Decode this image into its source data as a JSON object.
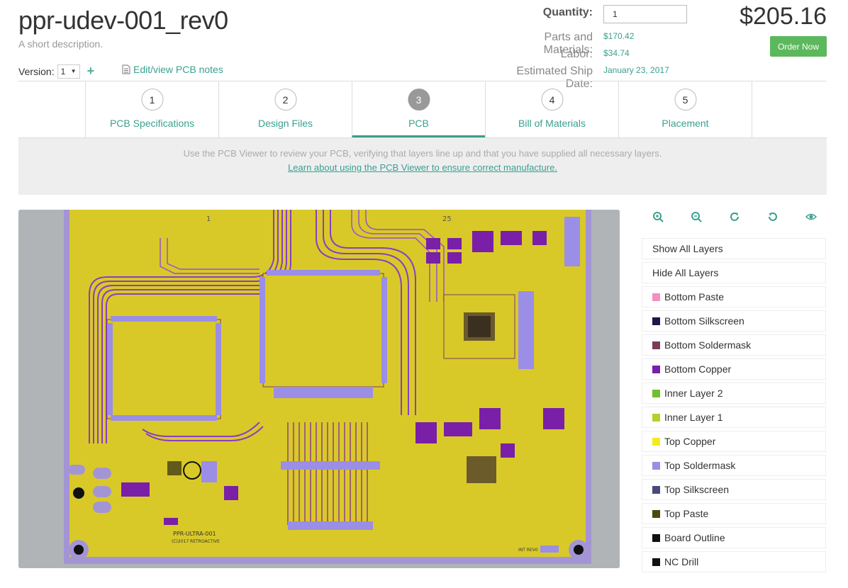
{
  "header": {
    "title": "ppr-udev-001_rev0",
    "description": "A short description.",
    "version_label": "Version:",
    "version_value": "1",
    "notes_link": "Edit/view PCB notes"
  },
  "summary": {
    "quantity_label": "Quantity:",
    "quantity_value": "1",
    "parts_label": "Parts and Materials:",
    "parts_value": "$170.42",
    "labor_label": "Labor:",
    "labor_value": "$34.74",
    "ship_label": "Estimated Ship Date:",
    "ship_value": "January 23, 2017",
    "total": "$205.16",
    "order_button": "Order Now"
  },
  "steps": [
    {
      "num": "1",
      "label": "PCB Specifications"
    },
    {
      "num": "2",
      "label": "Design Files"
    },
    {
      "num": "3",
      "label": "PCB"
    },
    {
      "num": "4",
      "label": "Bill of Materials"
    },
    {
      "num": "5",
      "label": "Placement"
    }
  ],
  "info": {
    "line1": "Use the PCB Viewer to review your PCB, verifying that layers line up and that you have supplied all necessary layers.",
    "line2": "Learn about using the PCB Viewer to ensure correct manufacture."
  },
  "board": {
    "labels": [
      "PPR-ULTRA-001",
      "(C)2017 RETROACTIVE",
      "1",
      "25",
      "INT REV0"
    ]
  },
  "tools": [
    "zoom-in-icon",
    "zoom-out-icon",
    "rotate-cw-icon",
    "rotate-ccw-icon",
    "eye-icon"
  ],
  "layer_actions": [
    "Show All Layers",
    "Hide All Layers"
  ],
  "layers": [
    {
      "name": "Bottom Paste",
      "color": "#f48fc0"
    },
    {
      "name": "Bottom Silkscreen",
      "color": "#1a1a4a"
    },
    {
      "name": "Bottom Soldermask",
      "color": "#7b3e5a"
    },
    {
      "name": "Bottom Copper",
      "color": "#7a1fa8"
    },
    {
      "name": "Inner Layer 2",
      "color": "#6fbf2f"
    },
    {
      "name": "Inner Layer 1",
      "color": "#b8cf2a"
    },
    {
      "name": "Top Copper",
      "color": "#f5ea1f"
    },
    {
      "name": "Top Soldermask",
      "color": "#9b8ee6"
    },
    {
      "name": "Top Silkscreen",
      "color": "#4a4a7a"
    },
    {
      "name": "Top Paste",
      "color": "#4a4a10"
    },
    {
      "name": "Board Outline",
      "color": "#111111"
    },
    {
      "name": "NC Drill",
      "color": "#111111"
    }
  ]
}
